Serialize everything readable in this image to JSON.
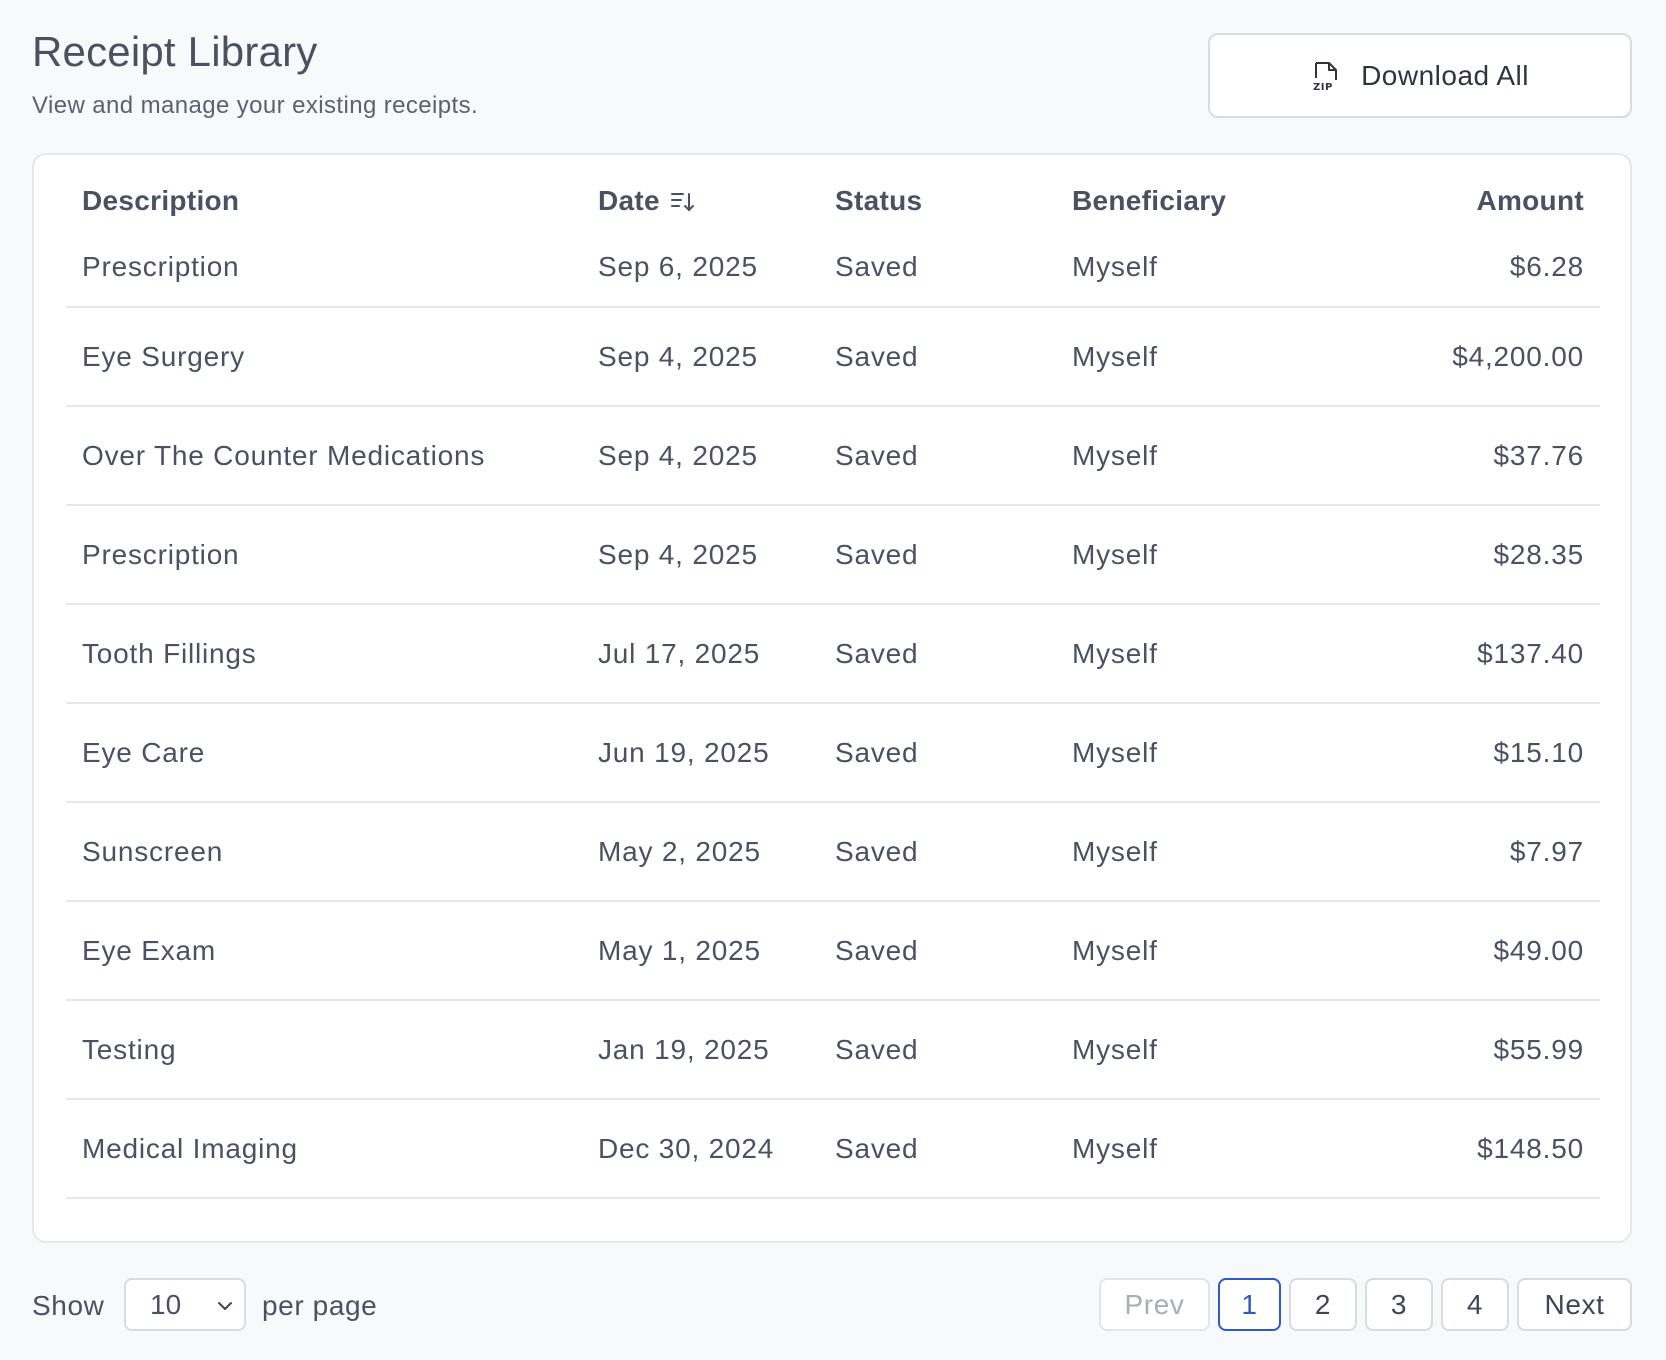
{
  "header": {
    "title": "Receipt Library",
    "subtitle": "View and manage your existing receipts.",
    "download_label": "Download All"
  },
  "table": {
    "columns": {
      "description": "Description",
      "date": "Date",
      "status": "Status",
      "beneficiary": "Beneficiary",
      "amount": "Amount"
    },
    "rows": [
      {
        "description": "Prescription",
        "date": "Sep 6, 2025",
        "status": "Saved",
        "beneficiary": "Myself",
        "amount": "$6.28"
      },
      {
        "description": "Eye Surgery",
        "date": "Sep 4, 2025",
        "status": "Saved",
        "beneficiary": "Myself",
        "amount": "$4,200.00"
      },
      {
        "description": "Over The Counter Medications",
        "date": "Sep 4, 2025",
        "status": "Saved",
        "beneficiary": "Myself",
        "amount": "$37.76"
      },
      {
        "description": "Prescription",
        "date": "Sep 4, 2025",
        "status": "Saved",
        "beneficiary": "Myself",
        "amount": "$28.35"
      },
      {
        "description": "Tooth Fillings",
        "date": "Jul 17, 2025",
        "status": "Saved",
        "beneficiary": "Myself",
        "amount": "$137.40"
      },
      {
        "description": "Eye Care",
        "date": "Jun 19, 2025",
        "status": "Saved",
        "beneficiary": "Myself",
        "amount": "$15.10"
      },
      {
        "description": "Sunscreen",
        "date": "May 2, 2025",
        "status": "Saved",
        "beneficiary": "Myself",
        "amount": "$7.97"
      },
      {
        "description": "Eye Exam",
        "date": "May 1, 2025",
        "status": "Saved",
        "beneficiary": "Myself",
        "amount": "$49.00"
      },
      {
        "description": "Testing",
        "date": "Jan 19, 2025",
        "status": "Saved",
        "beneficiary": "Myself",
        "amount": "$55.99"
      },
      {
        "description": "Medical Imaging",
        "date": "Dec 30, 2024",
        "status": "Saved",
        "beneficiary": "Myself",
        "amount": "$148.50"
      }
    ]
  },
  "pagination": {
    "show_label": "Show",
    "per_page_value": "10",
    "per_page_label": "per page",
    "prev_label": "Prev",
    "next_label": "Next",
    "pages": [
      "1",
      "2",
      "3",
      "4"
    ],
    "current_page": "1"
  },
  "colors": {
    "accent": "#2f59c9",
    "text": "#4a5262",
    "border": "#e4e7ec"
  },
  "icons": {
    "download": "zip-file-icon",
    "sort": "sort-descending-icon",
    "select": "chevron-down-icon"
  }
}
